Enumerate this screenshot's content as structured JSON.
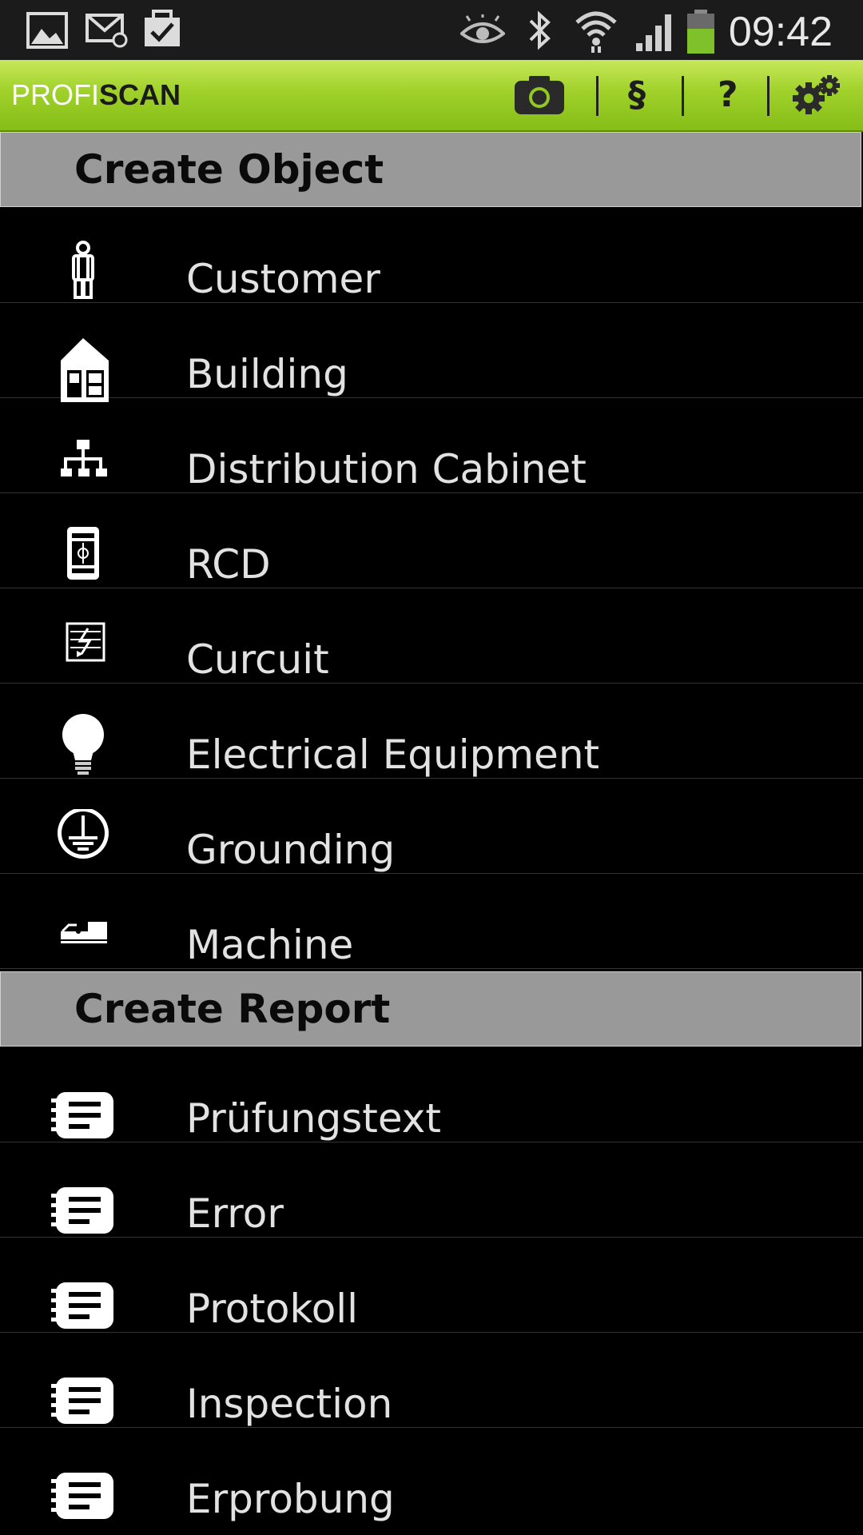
{
  "status_bar": {
    "time": "09:42",
    "icons": [
      "image-icon",
      "email-icon",
      "task-icon",
      "eye-icon",
      "bluetooth-icon",
      "wifi-icon",
      "signal-icon",
      "battery-icon"
    ]
  },
  "action_bar": {
    "logo_part1": "PROFI",
    "logo_part2": "SCAN",
    "paragraph_label": "§",
    "help_label": "?",
    "accent_color": "#9fd12a",
    "actions": [
      "camera-icon",
      "paragraph-icon",
      "help-icon",
      "settings-icon"
    ]
  },
  "create_object": {
    "title": "Create Object",
    "items": [
      {
        "label": "Customer",
        "icon": "person-icon"
      },
      {
        "label": "Building",
        "icon": "house-icon"
      },
      {
        "label": "Distribution Cabinet",
        "icon": "network-icon"
      },
      {
        "label": "RCD",
        "icon": "rcd-icon"
      },
      {
        "label": "Curcuit",
        "icon": "circuit-icon"
      },
      {
        "label": "Electrical Equipment",
        "icon": "lightbulb-icon"
      },
      {
        "label": "Grounding",
        "icon": "ground-icon"
      },
      {
        "label": "Machine",
        "icon": "machine-icon"
      }
    ]
  },
  "create_report": {
    "title": "Create Report",
    "items": [
      {
        "label": "Prüfungstext",
        "icon": "report-icon"
      },
      {
        "label": "Error",
        "icon": "report-icon"
      },
      {
        "label": "Protokoll",
        "icon": "report-icon"
      },
      {
        "label": "Inspection",
        "icon": "report-icon"
      },
      {
        "label": "Erprobung",
        "icon": "report-icon"
      }
    ]
  }
}
